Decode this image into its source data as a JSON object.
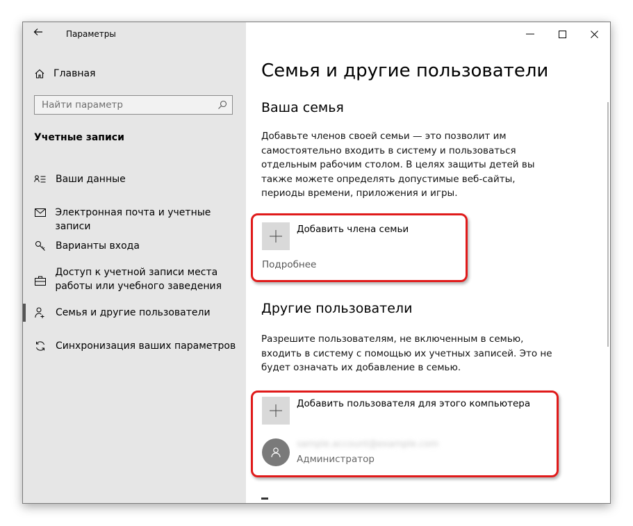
{
  "window": {
    "title": "Параметры",
    "controls": [
      "minimize-icon",
      "maximize-icon",
      "close-icon"
    ]
  },
  "sidebar": {
    "home_label": "Главная",
    "search_placeholder": "Найти параметр",
    "section_title": "Учетные записи",
    "items": [
      {
        "label": "Ваши данные",
        "icon": "user-info-icon"
      },
      {
        "label": "Электронная почта и учетные записи",
        "icon": "mail-icon"
      },
      {
        "label": "Варианты входа",
        "icon": "key-icon"
      },
      {
        "label": "Доступ к учетной записи места работы или учебного заведения",
        "icon": "briefcase-icon"
      },
      {
        "label": "Семья и другие пользователи",
        "icon": "family-icon",
        "selected": true
      },
      {
        "label": "Синхронизация ваших параметров",
        "icon": "sync-icon"
      }
    ]
  },
  "main": {
    "title": "Семья и другие пользователи",
    "family": {
      "heading": "Ваша семья",
      "description": "Добавьте членов своей семьи — это позволит им самостоятельно входить в систему и пользоваться отдельным рабочим столом. В целях защиты детей вы также можете определять допустимые веб-сайты, периоды времени, приложения и игры.",
      "add_label": "Добавить члена семьи",
      "more_link": "Подробнее"
    },
    "others": {
      "heading": "Другие пользователи",
      "description": "Разрешите пользователям, не включенным в семью, входить в систему с помощью их учетных записей. Это не будет означать их добавление в семью.",
      "add_label": "Добавить пользователя для этого компьютера",
      "user_email": "sample.account@example.com",
      "user_role": "Администратор"
    }
  },
  "colors": {
    "sidebar_bg": "#e6e6e6",
    "highlight": "#e01a1a",
    "plus_tile": "#d9d9d9",
    "avatar": "#7a7a7a"
  }
}
